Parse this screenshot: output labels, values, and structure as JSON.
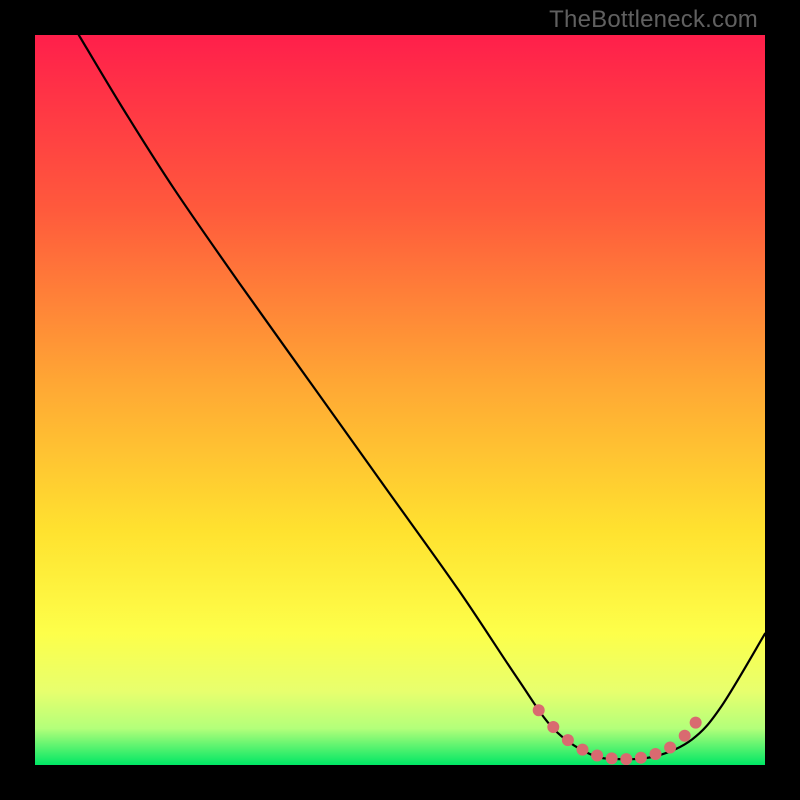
{
  "watermark": "TheBottleneck.com",
  "chart_data": {
    "type": "line",
    "title": "",
    "xlabel": "",
    "ylabel": "",
    "xlim": [
      0,
      100
    ],
    "ylim": [
      0,
      100
    ],
    "gradient_stops": [
      {
        "offset": 0,
        "color": "#ff1f4b"
      },
      {
        "offset": 24,
        "color": "#ff5a3c"
      },
      {
        "offset": 48,
        "color": "#ffa834"
      },
      {
        "offset": 68,
        "color": "#ffe22f"
      },
      {
        "offset": 82,
        "color": "#fdff4a"
      },
      {
        "offset": 90,
        "color": "#e7ff6e"
      },
      {
        "offset": 95,
        "color": "#b3ff7a"
      },
      {
        "offset": 100,
        "color": "#00e765"
      }
    ],
    "series": [
      {
        "name": "bottleneck-curve",
        "color": "#000000",
        "width": 2.2,
        "points": [
          {
            "x": 6,
            "y": 100
          },
          {
            "x": 12,
            "y": 90
          },
          {
            "x": 19,
            "y": 79
          },
          {
            "x": 28,
            "y": 66
          },
          {
            "x": 38,
            "y": 52
          },
          {
            "x": 48,
            "y": 38
          },
          {
            "x": 58,
            "y": 24
          },
          {
            "x": 66,
            "y": 12
          },
          {
            "x": 71,
            "y": 5
          },
          {
            "x": 76,
            "y": 1.5
          },
          {
            "x": 80,
            "y": 0.8
          },
          {
            "x": 85,
            "y": 1.2
          },
          {
            "x": 90,
            "y": 3.5
          },
          {
            "x": 94,
            "y": 8
          },
          {
            "x": 100,
            "y": 18
          }
        ]
      }
    ],
    "markers": {
      "name": "bottom-markers",
      "color": "#d96a70",
      "radius": 6,
      "points": [
        {
          "x": 69,
          "y": 7.5
        },
        {
          "x": 71,
          "y": 5.2
        },
        {
          "x": 73,
          "y": 3.4
        },
        {
          "x": 75,
          "y": 2.1
        },
        {
          "x": 77,
          "y": 1.3
        },
        {
          "x": 79,
          "y": 0.9
        },
        {
          "x": 81,
          "y": 0.8
        },
        {
          "x": 83,
          "y": 1.0
        },
        {
          "x": 85,
          "y": 1.5
        },
        {
          "x": 87,
          "y": 2.4
        },
        {
          "x": 89,
          "y": 4.0
        },
        {
          "x": 90.5,
          "y": 5.8
        }
      ]
    }
  }
}
